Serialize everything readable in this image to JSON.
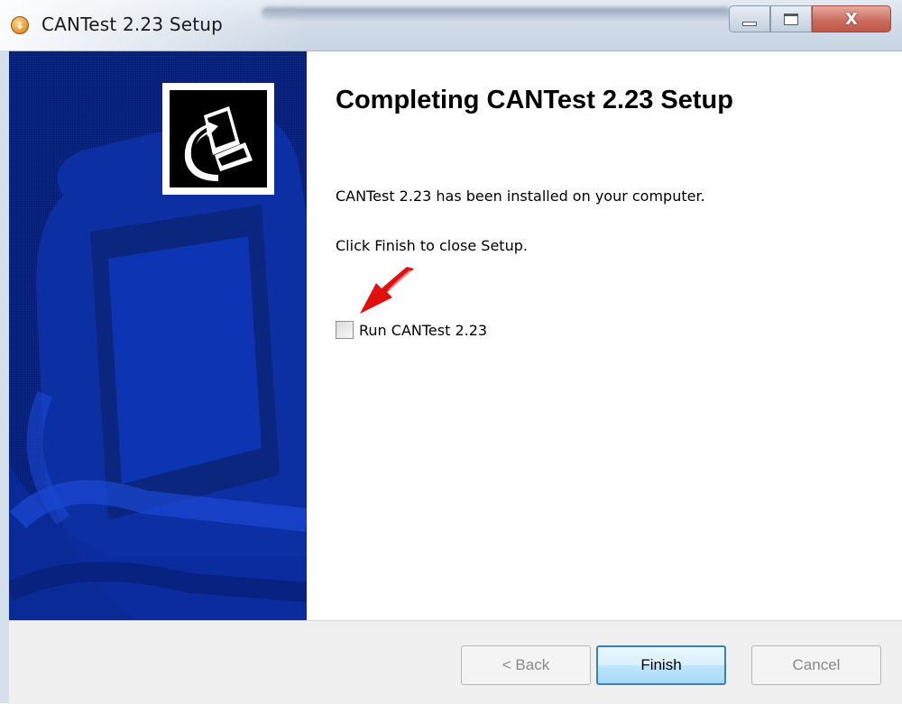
{
  "window": {
    "title": "CANTest 2.23 Setup",
    "icon": "installer-icon",
    "controls": {
      "minimize": "minimize-icon",
      "maximize": "maximize-icon",
      "close": "X"
    }
  },
  "banner": {
    "logo_icon": "computer-install-icon"
  },
  "content": {
    "heading": "Completing CANTest 2.23 Setup",
    "installed_text": "CANTest 2.23 has been installed on your computer.",
    "finish_text": "Click Finish to close Setup.",
    "run_option": {
      "label": "Run CANTest 2.23",
      "checked": false
    },
    "annotation_arrow_color": "#e01010"
  },
  "buttons": {
    "back": "< Back",
    "finish": "Finish",
    "cancel": "Cancel"
  },
  "colors": {
    "banner_blue": "#0a2a96",
    "finish_border": "#3c7fb1"
  }
}
